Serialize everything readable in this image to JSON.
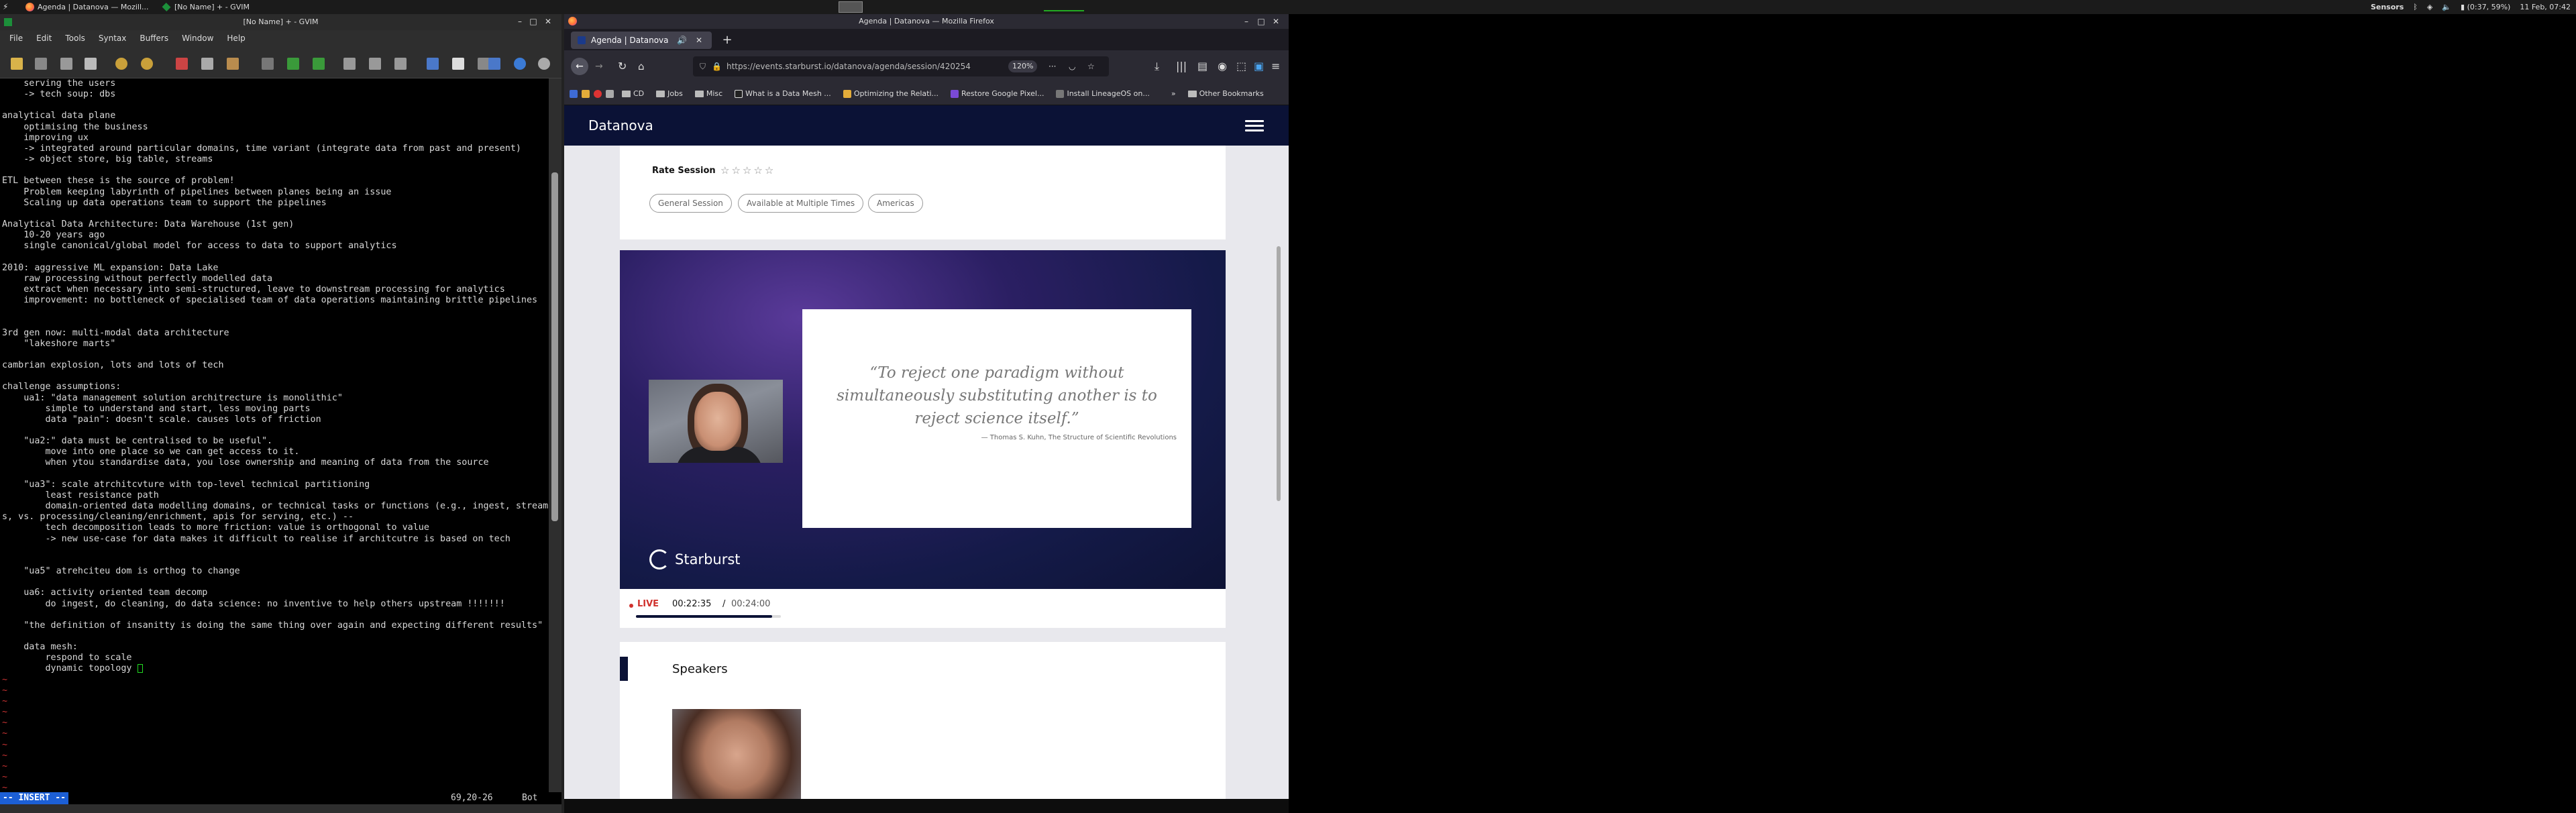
{
  "taskbar": {
    "tasks": [
      "Agenda | Datanova — Mozill...",
      "[No Name] + - GVIM"
    ],
    "sensors": "Sensors",
    "battery": "(0:37, 59%)",
    "clock": "11 Feb, 07:42"
  },
  "gvim": {
    "title": "[No Name] + - GVIM",
    "menu": [
      "File",
      "Edit",
      "Tools",
      "Syntax",
      "Buffers",
      "Window",
      "Help"
    ],
    "lines": [
      "    serving the users",
      "    -> tech soup: dbs",
      "",
      "analytical data plane",
      "    optimising the business",
      "    improving ux",
      "    -> integrated around particular domains, time variant (integrate data from past and present)",
      "    -> object store, big table, streams",
      "",
      "ETL between these is the source of problem!",
      "    Problem keeping labyrinth of pipelines between planes being an issue",
      "    Scaling up data operations team to support the pipelines",
      "",
      "Analytical Data Architecture: Data Warehouse (1st gen)",
      "    10-20 years ago",
      "    single canonical/global model for access to data to support analytics",
      "",
      "2010: aggressive ML expansion: Data Lake",
      "    raw processing without perfectly modelled data",
      "    extract when necessary into semi-structured, leave to downstream processing for analytics",
      "    improvement: no bottleneck of specialised team of data operations maintaining brittle pipelines",
      "",
      "",
      "3rd gen now: multi-modal data architecture",
      "    \"lakeshore marts\"",
      "",
      "cambrian explosion, lots and lots of tech",
      "",
      "challenge assumptions:",
      "    ua1: \"data management solution architrecture is monolithic\"",
      "        simple to understand and start, less moving parts",
      "        data \"pain\": doesn't scale. causes lots of friction",
      "",
      "    \"ua2:\" data must be centralised to be useful\".",
      "        move into one place so we can get access to it.",
      "        when ytou standardise data, you lose ownership and meaning of data from the source",
      "",
      "    \"ua3\": scale atrchitcvture with top-level technical partitioning",
      "        least resistance path",
      "        domain-oriented data modelling domains, or technical tasks or functions (e.g., ingest, stream",
      "s, vs. processing/cleaning/enrichment, apis for serving, etc.) --",
      "        tech decomposition leads to more friction: value is orthogonal to value",
      "        -> new use-case for data makes it difficult to realise if architcutre is based on tech",
      "",
      "",
      "    \"ua5\" atrehciteu dom is orthog to change",
      "",
      "    ua6: activity oriented team decomp",
      "        do ingest, do cleaning, do data science: no inventive to help others upstream !!!!!!!",
      "",
      "    \"the definition of insanitty is doing the same thing over again and expecting different results\"",
      "",
      "    data mesh:",
      "        respond to scale",
      "        dynamic topology "
    ],
    "tildes": 13,
    "mode": "-- INSERT --",
    "position": "69,20-26",
    "scroll": "Bot"
  },
  "firefox": {
    "title": "Agenda | Datanova — Mozilla Firefox",
    "tab": "Agenda | Datanova",
    "url": "https://events.starburst.io/datanova/agenda/session/420254",
    "zoom": "120%",
    "bookmarks": [
      "CD",
      "Jobs",
      "What is a Data Mesh ...",
      "Optimizing the Relati...",
      "Restore Google Pixel...",
      "Install LineageOS on...",
      "Other Bookmarks"
    ],
    "bookmark_misc": "Misc"
  },
  "page": {
    "brand": "Datanova",
    "rate_label": "Rate Session",
    "rating_stars": 5,
    "rating_value": 0,
    "tags": [
      "General Session",
      "Available at Multiple Times",
      "Americas"
    ],
    "quote": "“To reject one paradigm without simultaneously substituting another is to reject science itself.”",
    "quote_attribution": "— Thomas S. Kuhn, The Structure of Scientific Revolutions",
    "video_brand": "Starburst",
    "live_label": "LIVE",
    "current_time": "00:22:35",
    "separator": "/",
    "duration": "00:24:00",
    "progress": 0.94,
    "speakers_heading": "Speakers"
  },
  "colors": {
    "header_navy": "#0b1236",
    "live_red": "#d0312d",
    "insert_blue": "#1c5fd6"
  }
}
